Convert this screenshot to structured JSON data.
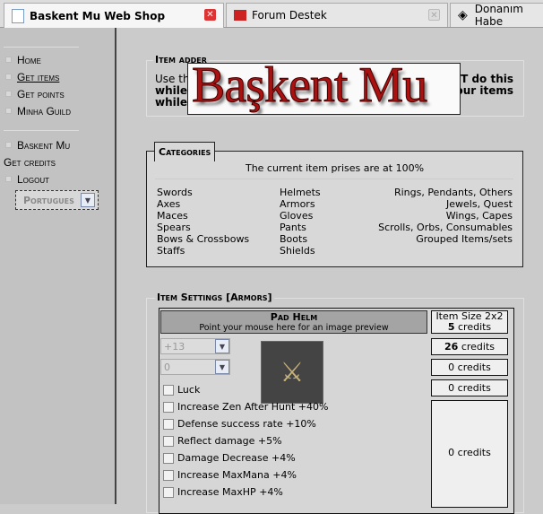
{
  "tabs": [
    {
      "title": "Baskent Mu Web Shop",
      "active": true
    },
    {
      "title": "Forum Destek",
      "active": false
    },
    {
      "title": "Donanım Habe",
      "active": false
    }
  ],
  "sidebar": {
    "items": [
      {
        "label": "Home"
      },
      {
        "label": "Get items"
      },
      {
        "label": "Get points"
      },
      {
        "label": "Minha Guild"
      },
      {
        "label": "Baskent Mu"
      },
      {
        "label": "Get credits"
      },
      {
        "label": "Logout"
      }
    ],
    "language": "Portugues"
  },
  "item_adder": {
    "title": "Item adder",
    "line1_left": "Use th",
    "line1_right": "T do this",
    "line2_left": "while",
    "line2_right": "our items",
    "line3_left": "while",
    "logo_text": "Başkent Mu"
  },
  "categories": {
    "title": "Categories",
    "note": "The current item prises are at 100%",
    "col1": [
      "Swords",
      "Axes",
      "Maces",
      "Spears",
      "Bows & Crossbows",
      "Staffs"
    ],
    "col2": [
      "Helmets",
      "Armors",
      "Gloves",
      "Pants",
      "Boots",
      "Shields"
    ],
    "col3": [
      "Rings, Pendants, Others",
      "Jewels, Quest",
      "Wings, Capes",
      "Scrolls, Orbs, Consumables",
      "Grouped Items/sets"
    ]
  },
  "item_settings": {
    "title": "Item Settings [Armors]",
    "item_name": "Pad Helm",
    "preview_hint": "Point your mouse here for an image preview",
    "level": "+13",
    "option": "0",
    "options": [
      "Luck",
      "Increase Zen After Hunt +40%",
      "Defense success rate +10%",
      "Reflect damage +5%",
      "Damage Decrease +4%",
      "Increase MaxMana +4%",
      "Increase MaxHP +4%"
    ],
    "size_label": "Item Size 2x2",
    "base_credits": "5",
    "level_credits": "26",
    "option_credits": "0",
    "luck_credits": "0",
    "excellent_credits": "0",
    "credits_word": "credits"
  }
}
